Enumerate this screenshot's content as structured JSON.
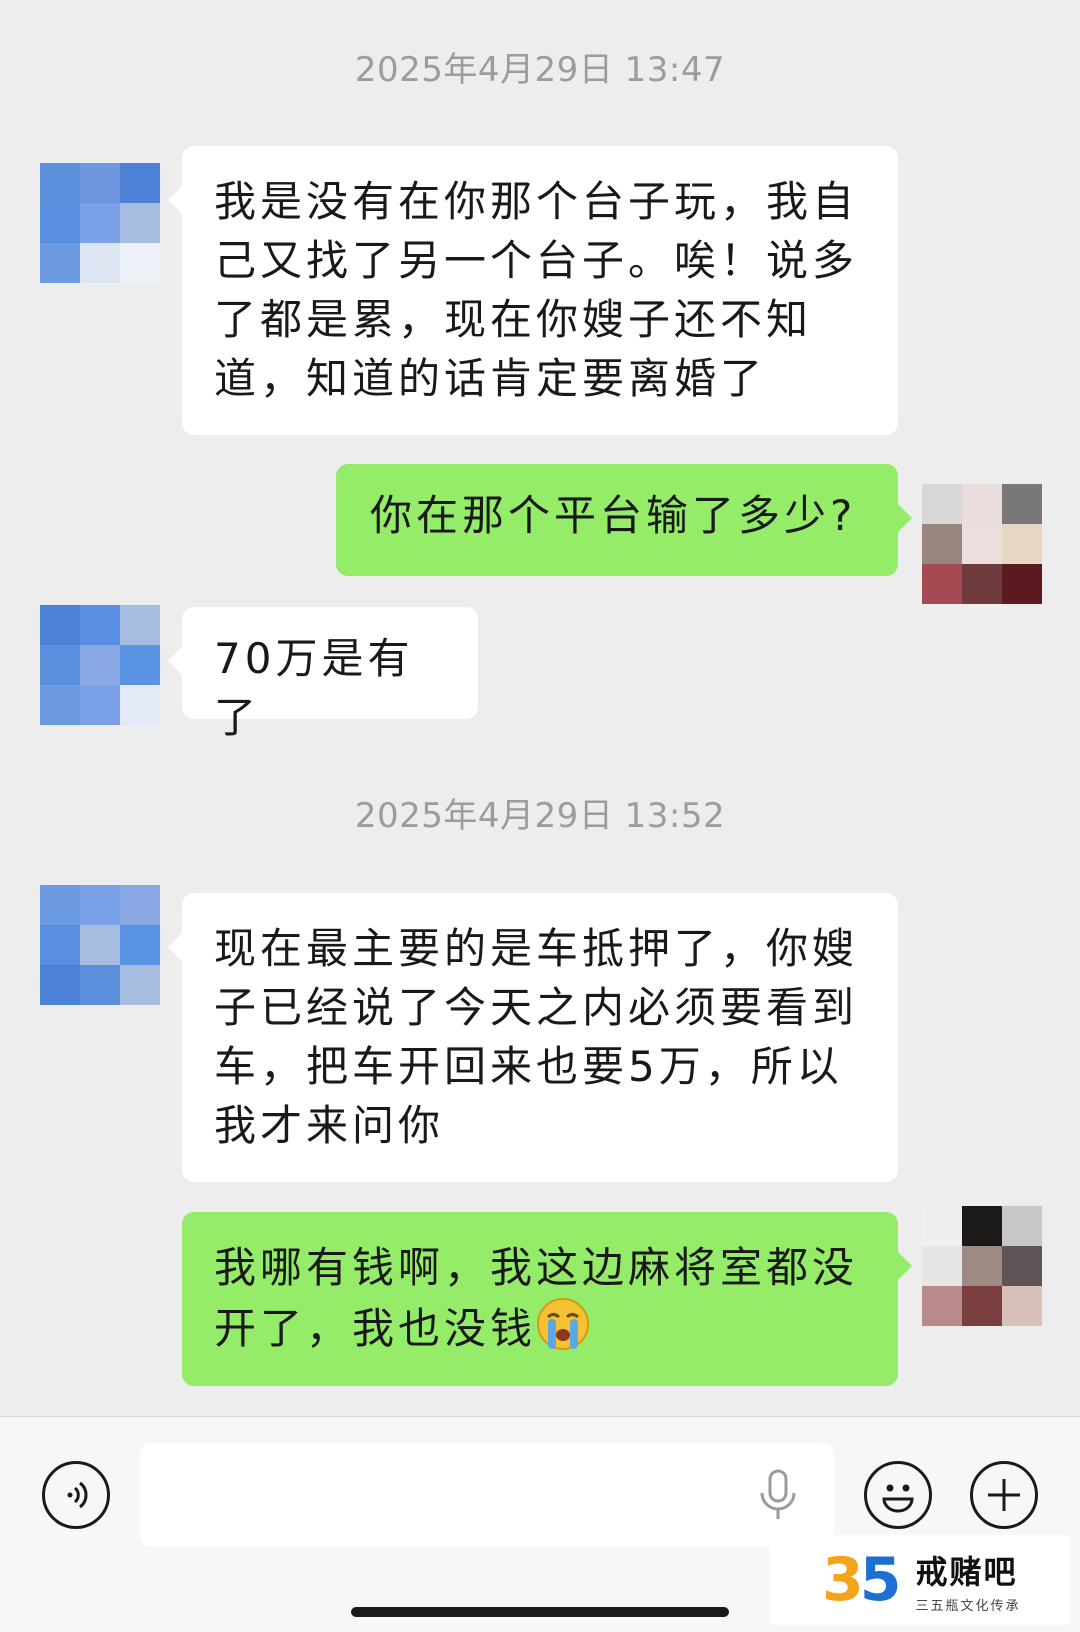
{
  "messages": [
    {
      "type": "time",
      "text": "2025年4月29日 13:47"
    },
    {
      "type": "received",
      "text": "我是没有在你那个台子玩，我自己又找了另一个台子。唉！说多了都是累，现在你嫂子还不知道，知道的话肯定要离婚了"
    },
    {
      "type": "sent",
      "text": "你在那个平台输了多少?"
    },
    {
      "type": "received",
      "text": "70万是有了"
    },
    {
      "type": "time",
      "text": "2025年4月29日 13:52"
    },
    {
      "type": "received",
      "text": "现在最主要的是车抵押了，你嫂子已经说了今天之内必须要看到车，把车开回来也要5万，所以我才来问你"
    },
    {
      "type": "sent",
      "text": "我哪有钱啊，我这边麻将室都没开了，我也没钱",
      "emoji": "loudly-crying-face"
    }
  ],
  "colors": {
    "background": "#ededed",
    "sent_bubble": "#95ec69",
    "received_bubble": "#ffffff",
    "timestamp": "#9c9c9c"
  },
  "input_bar": {
    "icons": [
      "voice-icon",
      "microphone-icon",
      "emoji-icon",
      "plus-icon"
    ]
  },
  "watermark": {
    "logo": "35",
    "title": "戒赌吧",
    "subtitle": "三五瓶文化传承"
  }
}
